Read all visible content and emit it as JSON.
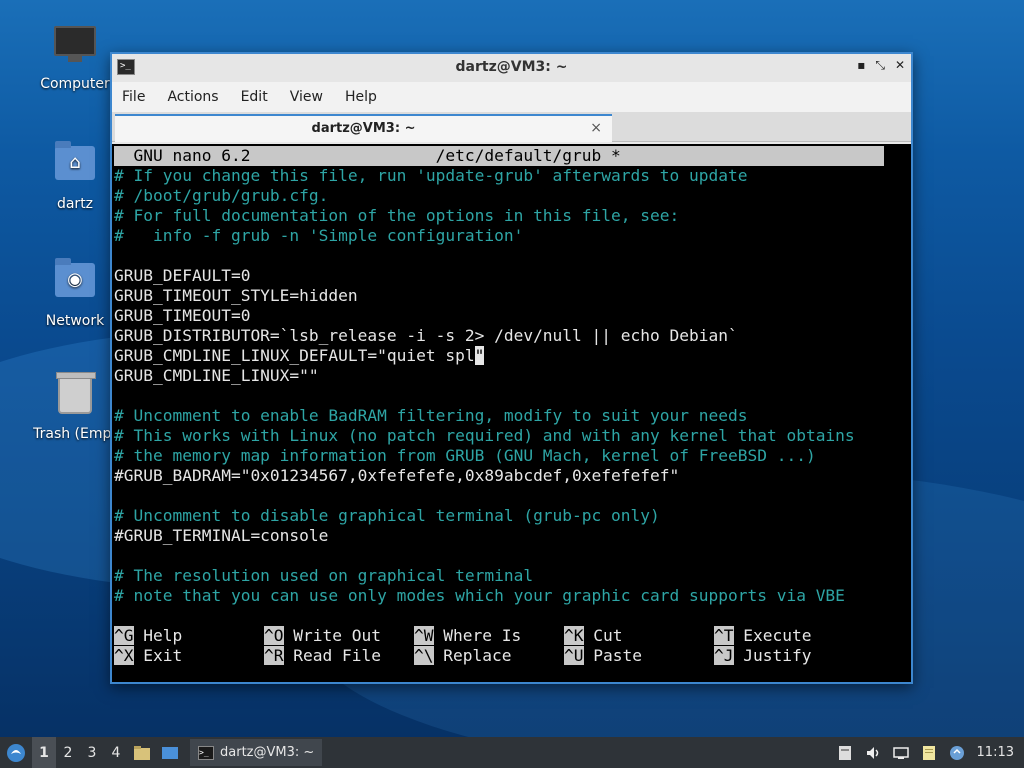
{
  "desktop": {
    "icons": [
      {
        "label": "Computer"
      },
      {
        "label": "dartz"
      },
      {
        "label": "Network"
      },
      {
        "label": "Trash (Empt"
      }
    ]
  },
  "window": {
    "title": "dartz@VM3: ~",
    "menu": [
      "File",
      "Actions",
      "Edit",
      "View",
      "Help"
    ],
    "tab_label": "dartz@VM3: ~",
    "tab_close": "×"
  },
  "nano": {
    "header": "  GNU nano 6.2                   /etc/default/grub *",
    "lines": [
      {
        "text": "# If you change this file, run 'update-grub' afterwards to update",
        "comment": true
      },
      {
        "text": "# /boot/grub/grub.cfg.",
        "comment": true
      },
      {
        "text": "# For full documentation of the options in this file, see:",
        "comment": true
      },
      {
        "text": "#   info -f grub -n 'Simple configuration'",
        "comment": true
      },
      {
        "text": "",
        "comment": false
      },
      {
        "text": "GRUB_DEFAULT=0",
        "comment": false
      },
      {
        "text": "GRUB_TIMEOUT_STYLE=hidden",
        "comment": false
      },
      {
        "text": "GRUB_TIMEOUT=0",
        "comment": false
      },
      {
        "text": "GRUB_DISTRIBUTOR=`lsb_release -i -s 2> /dev/null || echo Debian`",
        "comment": false
      },
      {
        "text": "GRUB_CMDLINE_LINUX_DEFAULT=\"quiet spl",
        "comment": false,
        "cursor": "\""
      },
      {
        "text": "GRUB_CMDLINE_LINUX=\"\"",
        "comment": false
      },
      {
        "text": "",
        "comment": false
      },
      {
        "text": "# Uncomment to enable BadRAM filtering, modify to suit your needs",
        "comment": true
      },
      {
        "text": "# This works with Linux (no patch required) and with any kernel that obtains",
        "comment": true
      },
      {
        "text": "# the memory map information from GRUB (GNU Mach, kernel of FreeBSD ...)",
        "comment": true
      },
      {
        "text": "#GRUB_BADRAM=\"0x01234567,0xfefefefe,0x89abcdef,0xefefefef\"",
        "comment": false
      },
      {
        "text": "",
        "comment": false
      },
      {
        "text": "# Uncomment to disable graphical terminal (grub-pc only)",
        "comment": true
      },
      {
        "text": "#GRUB_TERMINAL=console",
        "comment": false
      },
      {
        "text": "",
        "comment": false
      },
      {
        "text": "# The resolution used on graphical terminal",
        "comment": true
      },
      {
        "text": "# note that you can use only modes which your graphic card supports via VBE",
        "comment": true
      }
    ],
    "shortcuts_row1": [
      {
        "key": "^G",
        "label": "Help"
      },
      {
        "key": "^O",
        "label": "Write Out"
      },
      {
        "key": "^W",
        "label": "Where Is"
      },
      {
        "key": "^K",
        "label": "Cut"
      },
      {
        "key": "^T",
        "label": "Execute"
      }
    ],
    "shortcuts_row2": [
      {
        "key": "^X",
        "label": "Exit"
      },
      {
        "key": "^R",
        "label": "Read File"
      },
      {
        "key": "^\\",
        "label": "Replace"
      },
      {
        "key": "^U",
        "label": "Paste"
      },
      {
        "key": "^J",
        "label": "Justify"
      }
    ]
  },
  "taskbar": {
    "workspaces": [
      "1",
      "2",
      "3",
      "4"
    ],
    "active_workspace": "1",
    "task_label": "dartz@VM3: ~",
    "clock": "11:13"
  }
}
